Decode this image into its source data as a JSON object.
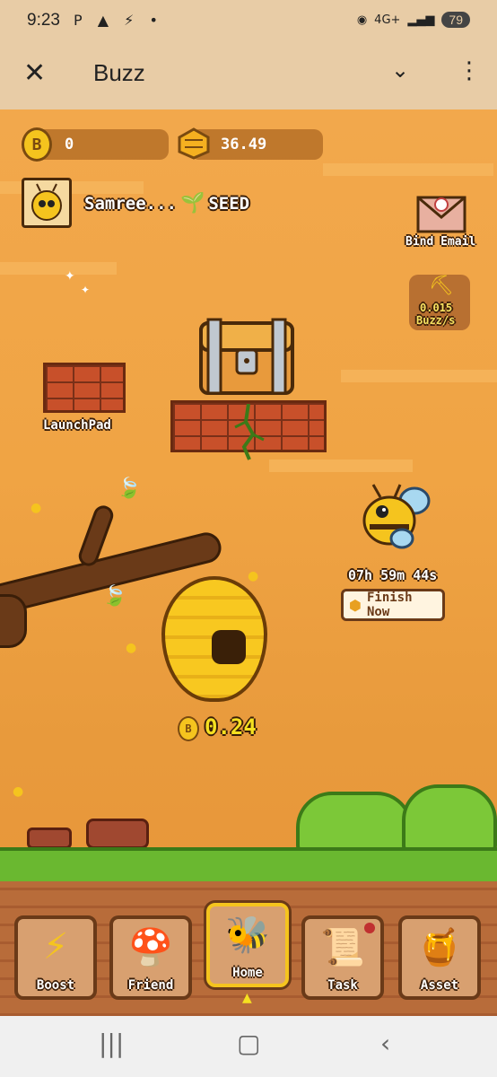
{
  "status_bar": {
    "time": "9:23",
    "icons": "P ▲ ⚡ •",
    "network": "4G+",
    "battery": "79"
  },
  "app_bar": {
    "title": "Buzz"
  },
  "currency": {
    "coin_value": "0",
    "honey_value": "36.49",
    "coin_glyph": "B"
  },
  "profile": {
    "name": "Samree...",
    "rank": "SEED"
  },
  "actions": {
    "bind_email": "Bind Email",
    "mining_rate": "0.015",
    "mining_unit": "Buzz/s"
  },
  "launchpad": {
    "label": "LaunchPad"
  },
  "bee_timer": {
    "countdown": "07h 59m 44s",
    "finish_label": "Finish Now"
  },
  "hive": {
    "earnings": "0.24"
  },
  "nav": [
    {
      "label": "Boost",
      "icon": "lightning-icon"
    },
    {
      "label": "Friend",
      "icon": "mushroom-icon"
    },
    {
      "label": "Home",
      "icon": "bee-icon"
    },
    {
      "label": "Task",
      "icon": "scroll-icon"
    },
    {
      "label": "Asset",
      "icon": "honey-jar-icon"
    }
  ],
  "colors": {
    "sky": "#f0a444",
    "brick": "#c8502a",
    "grass": "#6ab830",
    "honey": "#f8c820",
    "button": "#d8a070",
    "active_border": "#f5c41e"
  }
}
